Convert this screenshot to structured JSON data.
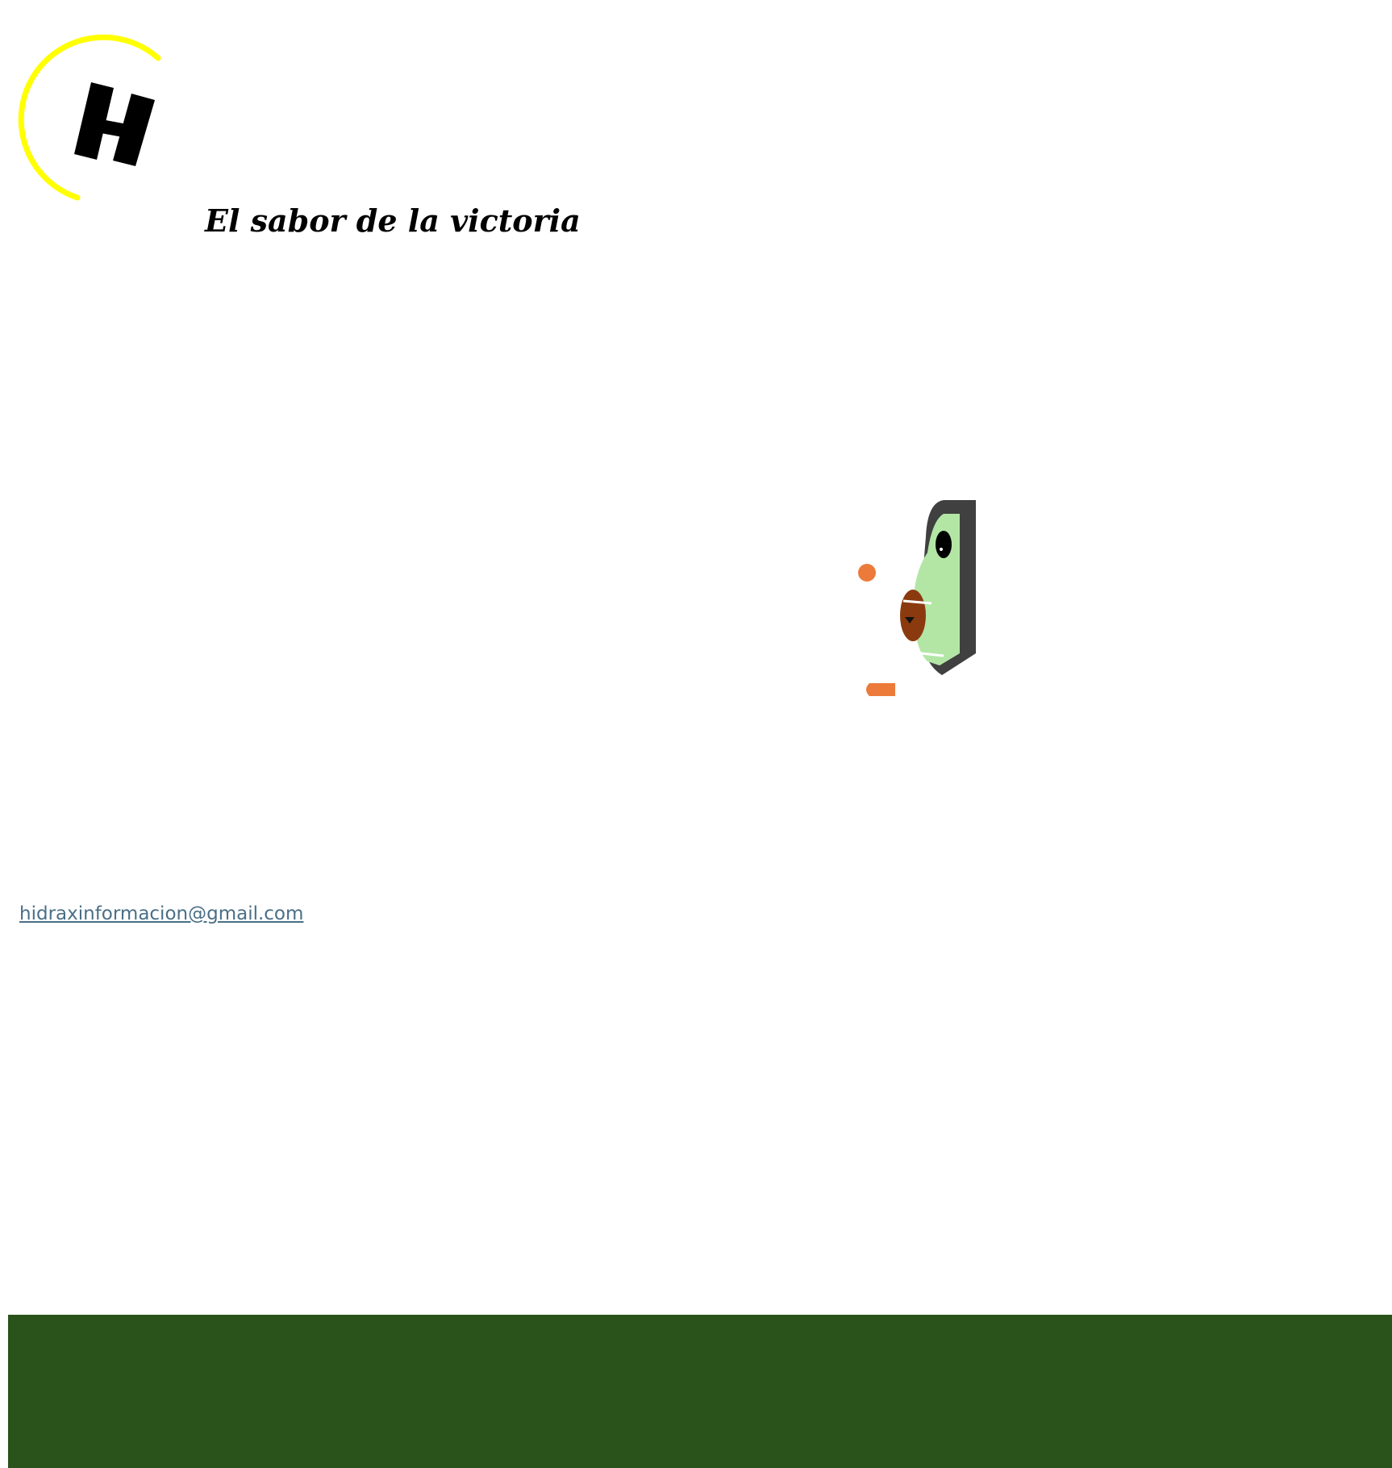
{
  "header": {
    "logo_icon": "hidrax-h-logo",
    "tagline": "El sabor de la victoria"
  },
  "hero": {
    "illustration_icon": "avocado-mascot-peeking"
  },
  "contact": {
    "email": "hidraxinformacion@gmail.com"
  },
  "footer": {
    "background": "#29531a"
  },
  "colors": {
    "logo_arc": "#ffff00",
    "logo_mark": "#000000",
    "mascot_skin": "#b3e6a5",
    "mascot_shell": "#404040",
    "mascot_seed": "#8b3a0f",
    "mascot_accent": "#ec7a3a",
    "link": "#4a6f86"
  }
}
